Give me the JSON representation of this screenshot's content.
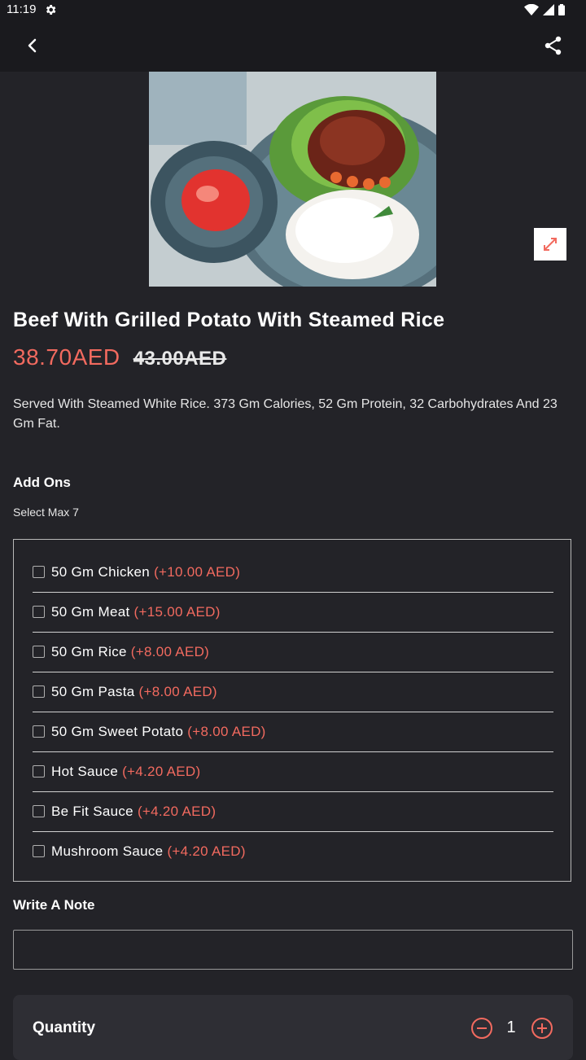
{
  "status_bar": {
    "time": "11:19"
  },
  "product": {
    "title": "Beef With Grilled Potato With Steamed Rice",
    "price": "38.70AED",
    "old_price": "43.00AED",
    "description": "Served With Steamed White Rice. 373 Gm Calories, 52 Gm Protein, 32 Carbohydrates And 23 Gm Fat."
  },
  "addons": {
    "title": "Add Ons",
    "subtitle": "Select Max 7",
    "items": [
      {
        "name": "50 Gm Chicken",
        "price": "(+10.00 AED)"
      },
      {
        "name": "50 Gm Meat",
        "price": "(+15.00 AED)"
      },
      {
        "name": "50 Gm Rice",
        "price": "(+8.00 AED)"
      },
      {
        "name": "50 Gm Pasta",
        "price": "(+8.00 AED)"
      },
      {
        "name": "50 Gm Sweet Potato",
        "price": "(+8.00 AED)"
      },
      {
        "name": "Hot Sauce",
        "price": "(+4.20 AED)"
      },
      {
        "name": "Be Fit Sauce",
        "price": "(+4.20 AED)"
      },
      {
        "name": "Mushroom Sauce",
        "price": "(+4.20 AED)"
      }
    ]
  },
  "note": {
    "title": "Write A Note",
    "placeholder": ""
  },
  "quantity": {
    "label": "Quantity",
    "value": "1"
  },
  "colors": {
    "accent": "#f26a5f",
    "background": "#232328",
    "app_bar": "#1a1a1e"
  }
}
